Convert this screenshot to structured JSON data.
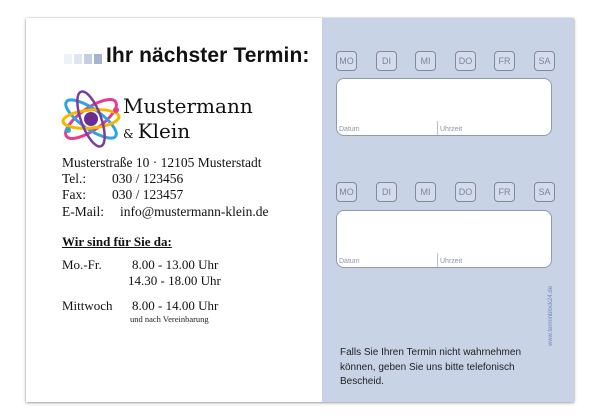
{
  "header": {
    "title": "Ihr nächster Termin:"
  },
  "brand": {
    "line1": "Mustermann",
    "amp": "&",
    "line2": "Klein",
    "logo_icon": "atom-logo-icon"
  },
  "contact": {
    "street": "Musterstraße 10  ·  12105 Musterstadt",
    "tel_label": "Tel.:",
    "tel": "030 / 123456",
    "fax_label": "Fax:",
    "fax": "030 / 123457",
    "email_label": "E-Mail:",
    "email": "info@mustermann-klein.de"
  },
  "hours": {
    "title": "Wir sind für Sie da:",
    "rows": [
      {
        "day": "Mo.-Fr.",
        "time": "8.00 - 13.00 Uhr"
      },
      {
        "day": "",
        "time": "14.30 - 18.00 Uhr"
      },
      {
        "day": "Mittwoch",
        "time": "8.00 - 14.00 Uhr"
      }
    ],
    "note": "und nach Vereinbarung"
  },
  "appointment": {
    "days": [
      "MO",
      "DI",
      "MI",
      "DO",
      "FR",
      "SA"
    ],
    "date_label": "Datum",
    "time_label": "Uhrzeit"
  },
  "footer": {
    "notice": "Falls Sie Ihren Termin nicht wahrnehmen können, geben Sie uns bitte telefonisch Bescheid.",
    "website": "www.terminblock24.de"
  },
  "colors": {
    "panel": "#c8d3e6",
    "stripe_dark": "#8fa1c9",
    "stripe_light": "#dfe5f1"
  }
}
